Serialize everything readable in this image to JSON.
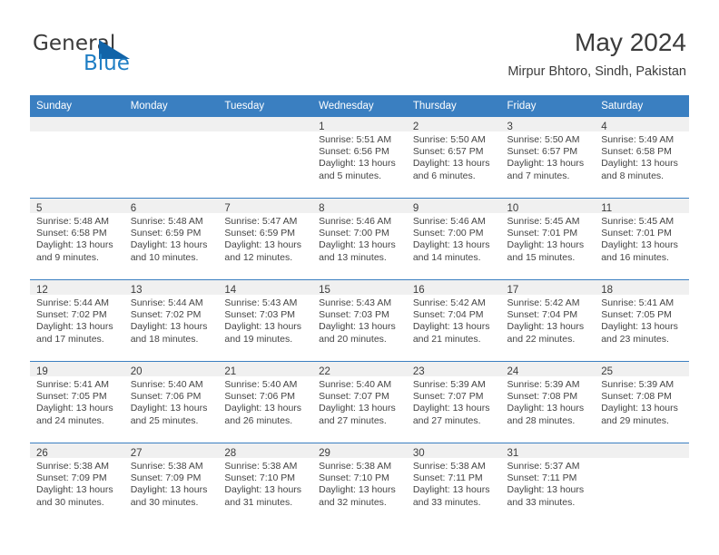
{
  "brand": {
    "line1": "General",
    "line2": "Blue",
    "mark": "triangle-logo",
    "accent": "#1f7ec4"
  },
  "header": {
    "title": "May 2024",
    "subtitle": "Mirpur Bhtoro, Sindh, Pakistan"
  },
  "colors": {
    "header_bar": "#3a7fc1",
    "day_band": "#f0f0f0",
    "text": "#3c3c3c"
  },
  "weekdays": [
    "Sunday",
    "Monday",
    "Tuesday",
    "Wednesday",
    "Thursday",
    "Friday",
    "Saturday"
  ],
  "weeks": [
    [
      {
        "day": ""
      },
      {
        "day": ""
      },
      {
        "day": ""
      },
      {
        "day": "1",
        "sunrise": "Sunrise: 5:51 AM",
        "sunset": "Sunset: 6:56 PM",
        "daylight1": "Daylight: 13 hours",
        "daylight2": "and 5 minutes."
      },
      {
        "day": "2",
        "sunrise": "Sunrise: 5:50 AM",
        "sunset": "Sunset: 6:57 PM",
        "daylight1": "Daylight: 13 hours",
        "daylight2": "and 6 minutes."
      },
      {
        "day": "3",
        "sunrise": "Sunrise: 5:50 AM",
        "sunset": "Sunset: 6:57 PM",
        "daylight1": "Daylight: 13 hours",
        "daylight2": "and 7 minutes."
      },
      {
        "day": "4",
        "sunrise": "Sunrise: 5:49 AM",
        "sunset": "Sunset: 6:58 PM",
        "daylight1": "Daylight: 13 hours",
        "daylight2": "and 8 minutes."
      }
    ],
    [
      {
        "day": "5",
        "sunrise": "Sunrise: 5:48 AM",
        "sunset": "Sunset: 6:58 PM",
        "daylight1": "Daylight: 13 hours",
        "daylight2": "and 9 minutes."
      },
      {
        "day": "6",
        "sunrise": "Sunrise: 5:48 AM",
        "sunset": "Sunset: 6:59 PM",
        "daylight1": "Daylight: 13 hours",
        "daylight2": "and 10 minutes."
      },
      {
        "day": "7",
        "sunrise": "Sunrise: 5:47 AM",
        "sunset": "Sunset: 6:59 PM",
        "daylight1": "Daylight: 13 hours",
        "daylight2": "and 12 minutes."
      },
      {
        "day": "8",
        "sunrise": "Sunrise: 5:46 AM",
        "sunset": "Sunset: 7:00 PM",
        "daylight1": "Daylight: 13 hours",
        "daylight2": "and 13 minutes."
      },
      {
        "day": "9",
        "sunrise": "Sunrise: 5:46 AM",
        "sunset": "Sunset: 7:00 PM",
        "daylight1": "Daylight: 13 hours",
        "daylight2": "and 14 minutes."
      },
      {
        "day": "10",
        "sunrise": "Sunrise: 5:45 AM",
        "sunset": "Sunset: 7:01 PM",
        "daylight1": "Daylight: 13 hours",
        "daylight2": "and 15 minutes."
      },
      {
        "day": "11",
        "sunrise": "Sunrise: 5:45 AM",
        "sunset": "Sunset: 7:01 PM",
        "daylight1": "Daylight: 13 hours",
        "daylight2": "and 16 minutes."
      }
    ],
    [
      {
        "day": "12",
        "sunrise": "Sunrise: 5:44 AM",
        "sunset": "Sunset: 7:02 PM",
        "daylight1": "Daylight: 13 hours",
        "daylight2": "and 17 minutes."
      },
      {
        "day": "13",
        "sunrise": "Sunrise: 5:44 AM",
        "sunset": "Sunset: 7:02 PM",
        "daylight1": "Daylight: 13 hours",
        "daylight2": "and 18 minutes."
      },
      {
        "day": "14",
        "sunrise": "Sunrise: 5:43 AM",
        "sunset": "Sunset: 7:03 PM",
        "daylight1": "Daylight: 13 hours",
        "daylight2": "and 19 minutes."
      },
      {
        "day": "15",
        "sunrise": "Sunrise: 5:43 AM",
        "sunset": "Sunset: 7:03 PM",
        "daylight1": "Daylight: 13 hours",
        "daylight2": "and 20 minutes."
      },
      {
        "day": "16",
        "sunrise": "Sunrise: 5:42 AM",
        "sunset": "Sunset: 7:04 PM",
        "daylight1": "Daylight: 13 hours",
        "daylight2": "and 21 minutes."
      },
      {
        "day": "17",
        "sunrise": "Sunrise: 5:42 AM",
        "sunset": "Sunset: 7:04 PM",
        "daylight1": "Daylight: 13 hours",
        "daylight2": "and 22 minutes."
      },
      {
        "day": "18",
        "sunrise": "Sunrise: 5:41 AM",
        "sunset": "Sunset: 7:05 PM",
        "daylight1": "Daylight: 13 hours",
        "daylight2": "and 23 minutes."
      }
    ],
    [
      {
        "day": "19",
        "sunrise": "Sunrise: 5:41 AM",
        "sunset": "Sunset: 7:05 PM",
        "daylight1": "Daylight: 13 hours",
        "daylight2": "and 24 minutes."
      },
      {
        "day": "20",
        "sunrise": "Sunrise: 5:40 AM",
        "sunset": "Sunset: 7:06 PM",
        "daylight1": "Daylight: 13 hours",
        "daylight2": "and 25 minutes."
      },
      {
        "day": "21",
        "sunrise": "Sunrise: 5:40 AM",
        "sunset": "Sunset: 7:06 PM",
        "daylight1": "Daylight: 13 hours",
        "daylight2": "and 26 minutes."
      },
      {
        "day": "22",
        "sunrise": "Sunrise: 5:40 AM",
        "sunset": "Sunset: 7:07 PM",
        "daylight1": "Daylight: 13 hours",
        "daylight2": "and 27 minutes."
      },
      {
        "day": "23",
        "sunrise": "Sunrise: 5:39 AM",
        "sunset": "Sunset: 7:07 PM",
        "daylight1": "Daylight: 13 hours",
        "daylight2": "and 27 minutes."
      },
      {
        "day": "24",
        "sunrise": "Sunrise: 5:39 AM",
        "sunset": "Sunset: 7:08 PM",
        "daylight1": "Daylight: 13 hours",
        "daylight2": "and 28 minutes."
      },
      {
        "day": "25",
        "sunrise": "Sunrise: 5:39 AM",
        "sunset": "Sunset: 7:08 PM",
        "daylight1": "Daylight: 13 hours",
        "daylight2": "and 29 minutes."
      }
    ],
    [
      {
        "day": "26",
        "sunrise": "Sunrise: 5:38 AM",
        "sunset": "Sunset: 7:09 PM",
        "daylight1": "Daylight: 13 hours",
        "daylight2": "and 30 minutes."
      },
      {
        "day": "27",
        "sunrise": "Sunrise: 5:38 AM",
        "sunset": "Sunset: 7:09 PM",
        "daylight1": "Daylight: 13 hours",
        "daylight2": "and 30 minutes."
      },
      {
        "day": "28",
        "sunrise": "Sunrise: 5:38 AM",
        "sunset": "Sunset: 7:10 PM",
        "daylight1": "Daylight: 13 hours",
        "daylight2": "and 31 minutes."
      },
      {
        "day": "29",
        "sunrise": "Sunrise: 5:38 AM",
        "sunset": "Sunset: 7:10 PM",
        "daylight1": "Daylight: 13 hours",
        "daylight2": "and 32 minutes."
      },
      {
        "day": "30",
        "sunrise": "Sunrise: 5:38 AM",
        "sunset": "Sunset: 7:11 PM",
        "daylight1": "Daylight: 13 hours",
        "daylight2": "and 33 minutes."
      },
      {
        "day": "31",
        "sunrise": "Sunrise: 5:37 AM",
        "sunset": "Sunset: 7:11 PM",
        "daylight1": "Daylight: 13 hours",
        "daylight2": "and 33 minutes."
      },
      {
        "day": ""
      }
    ]
  ]
}
